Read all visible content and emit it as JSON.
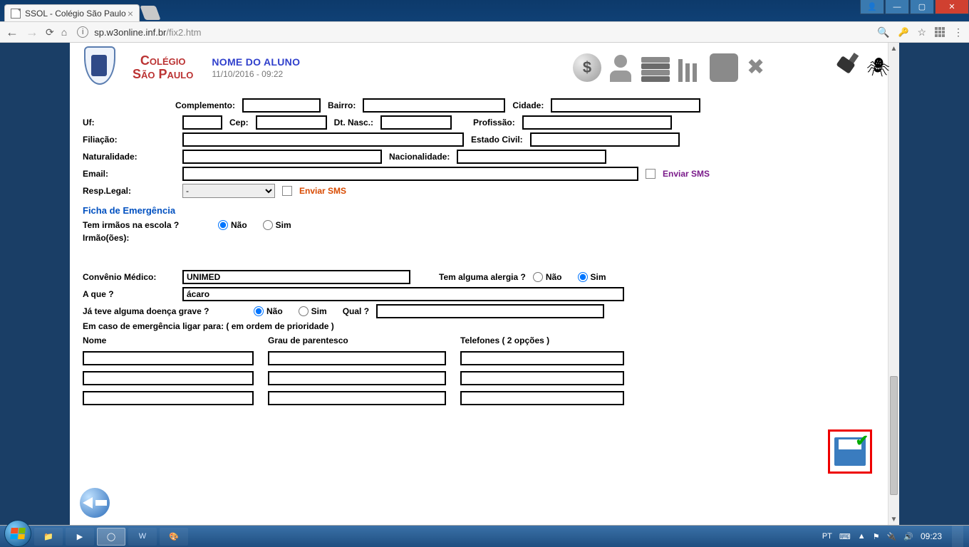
{
  "window": {
    "tab_title": "SSOL - Colégio São Paulo",
    "url_host": "sp.w3online.inf.br",
    "url_path": "/fix2.htm"
  },
  "header": {
    "brand_line1": "Colégio",
    "brand_line2": "São Paulo",
    "student_name": "NOME DO ALUNO",
    "timestamp": "11/10/2016 - 09:22"
  },
  "form": {
    "complemento_label": "Complemento:",
    "bairro_label": "Bairro:",
    "cidade_label": "Cidade:",
    "uf_label": "Uf:",
    "cep_label": "Cep:",
    "dtnasc_label": "Dt. Nasc.:",
    "profissao_label": "Profissão:",
    "filiacao_label": "Filiação:",
    "estadocivil_label": "Estado Civil:",
    "naturalidade_label": "Naturalidade:",
    "nacionalidade_label": "Nacionalidade:",
    "email_label": "Email:",
    "enviar_sms_email": "Enviar SMS",
    "resplegal_label": "Resp.Legal:",
    "resplegal_value": "-",
    "enviar_sms_resp": "Enviar SMS",
    "section_emerg": "Ficha de Emergência",
    "irmaos_q": "Tem irmãos na escola ?",
    "nao": "Não",
    "sim": "Sim",
    "irmaoes_label": "Irmão(ões):",
    "convenio_label": "Convênio Médico:",
    "convenio_value": "UNIMED",
    "alergia_q": "Tem alguma alergia ?",
    "aque_label": "A que ?",
    "aque_value": "ácaro",
    "doenca_q": "Já teve alguma doença grave ?",
    "qual_label": "Qual ?",
    "emerg_ligar": "Em caso de emergência ligar para: ( em ordem de prioridade )",
    "col_nome": "Nome",
    "col_grau": "Grau de parentesco",
    "col_tel": "Telefones ( 2 opções )"
  },
  "taskbar": {
    "lang": "PT",
    "clock": "09:23"
  }
}
